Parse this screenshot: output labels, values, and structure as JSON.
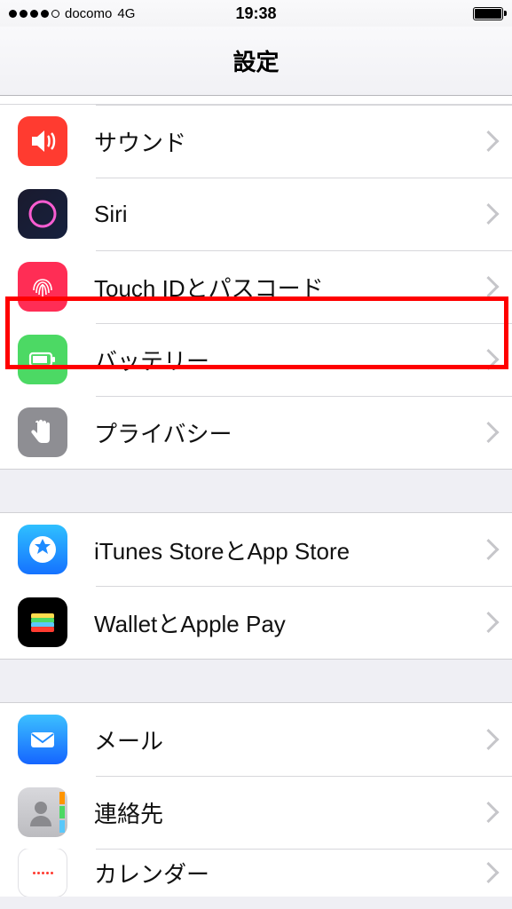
{
  "status": {
    "carrier": "docomo",
    "network": "4G",
    "time": "19:38"
  },
  "nav": {
    "title": "設定"
  },
  "group1": [
    {
      "id": "sounds",
      "label": "サウンド",
      "icon": "speaker-icon",
      "bg": "#ff3b30"
    },
    {
      "id": "siri",
      "label": "Siri",
      "icon": "siri-icon",
      "bg": "siri"
    },
    {
      "id": "touchid",
      "label": "Touch IDとパスコード",
      "icon": "fingerprint-icon",
      "bg": "#ff2d55"
    },
    {
      "id": "battery",
      "label": "バッテリー",
      "icon": "battery-icon",
      "bg": "#4cd964",
      "highlighted": true
    },
    {
      "id": "privacy",
      "label": "プライバシー",
      "icon": "hand-icon",
      "bg": "#8e8e93"
    }
  ],
  "group2": [
    {
      "id": "itunes",
      "label": "iTunes StoreとApp Store",
      "icon": "appstore-icon",
      "bg": "appstore"
    },
    {
      "id": "wallet",
      "label": "WalletとApple Pay",
      "icon": "wallet-icon",
      "bg": "#000000"
    }
  ],
  "group3": [
    {
      "id": "mail",
      "label": "メール",
      "icon": "mail-icon",
      "bg": "#1e8bff"
    },
    {
      "id": "contacts",
      "label": "連絡先",
      "icon": "contacts-icon",
      "bg": "#bcbcc0"
    },
    {
      "id": "calendar",
      "label": "カレンダー",
      "icon": "calendar-icon",
      "bg": "#ffffff"
    }
  ]
}
